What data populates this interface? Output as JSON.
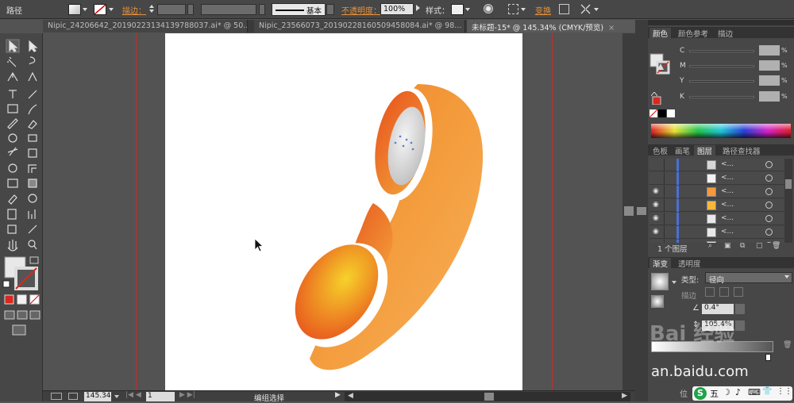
{
  "control_bar": {
    "path_label": "路径",
    "stroke_label": "描边",
    "stroke_profile": "基本",
    "opacity_label": "不透明度",
    "opacity_value": "100%",
    "style_label": "样式",
    "transform_label": "变换",
    "colon": "："
  },
  "tabs": [
    {
      "label": "Nipic_24206642_20190223134139788037.ai* @ 50..."
    },
    {
      "label": "Nipic_23566073_20190228160509458084.ai* @ 98..."
    },
    {
      "label": "未标题-15* @ 145.34% (CMYK/预览)"
    }
  ],
  "tab_close": "×",
  "color_panel": {
    "tabs": [
      "颜色",
      "颜色参考",
      "描边"
    ],
    "channels": [
      {
        "name": "C",
        "unit": "%"
      },
      {
        "name": "M",
        "unit": "%"
      },
      {
        "name": "Y",
        "unit": "%"
      },
      {
        "name": "K",
        "unit": "%"
      }
    ]
  },
  "layers_panel": {
    "tabs": [
      "色板",
      "画笔",
      "图层",
      "路径查找器"
    ],
    "rows": [
      {
        "name": "<...",
        "visible": false
      },
      {
        "name": "<...",
        "visible": false
      },
      {
        "name": "<...",
        "visible": true
      },
      {
        "name": "<...",
        "visible": true
      },
      {
        "name": "<...",
        "visible": true
      },
      {
        "name": "<...",
        "visible": true
      },
      {
        "name": "<...",
        "visible": false
      }
    ],
    "footer": "1 个图层"
  },
  "gradient_panel": {
    "tabs": [
      "渐变",
      "透明度"
    ],
    "type_label": "类型:",
    "type_value": "径向",
    "stroke_label": "描边",
    "angle_value": "0.4°",
    "aspect_value": "105.4%"
  },
  "status_bar": {
    "zoom": "145.34",
    "artboard": "1",
    "tool_name": "编组选择"
  },
  "watermark": {
    "brand": "Bai 经验",
    "domain": "an.baidu.com",
    "suffix": "位"
  },
  "taskbar": {
    "ime_items": [
      "S",
      "五",
      "☽",
      "♪",
      "⌨",
      "👕",
      "⋮⋮"
    ]
  },
  "colors": {
    "accent_orange": "#e8913a",
    "guide_red": "#c0302c",
    "fill_swatch": "#d8281f"
  }
}
